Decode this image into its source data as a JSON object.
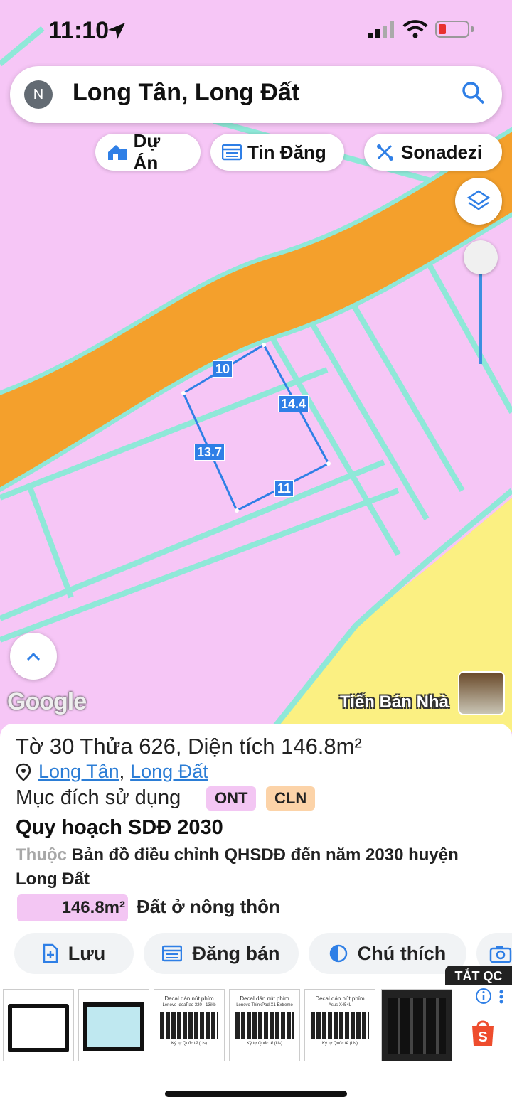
{
  "status_bar": {
    "time": "11:10"
  },
  "search": {
    "avatar_letter": "N",
    "query": "Long Tân, Long Đất"
  },
  "chips": [
    {
      "label": "Dự Án",
      "icon": "house-icon"
    },
    {
      "label": "Tin Đăng",
      "icon": "list-icon"
    },
    {
      "label": "Sonadezi",
      "icon": "tools-icon"
    }
  ],
  "map": {
    "edge_labels": [
      "10",
      "14.4",
      "13.7",
      "11"
    ],
    "google_logo": "Google",
    "watermark": "Tiến Bán Nhà"
  },
  "parcel": {
    "title": "Tờ 30 Thửa 626, Diện tích 146.8m²",
    "ward": "Long Tân",
    "separator": ",",
    "district": "Long Đất",
    "purpose_label": "Mục đích sử dụng",
    "purpose_tags": [
      "ONT",
      "CLN"
    ],
    "plan_title": "Quy hoạch SDĐ 2030",
    "plan_prefix": "Thuộc",
    "plan_desc": "Bản đồ điều chỉnh QHSDĐ đến năm 2030 huyện Long Đất",
    "area_value": "146.8m²",
    "area_type": "Đất ở nông thôn"
  },
  "actions": {
    "save": "Lưu",
    "post": "Đăng bán",
    "legend": "Chú thích"
  },
  "ads": {
    "close_label": "TẮT QC",
    "items": [
      {
        "caption": ""
      },
      {
        "caption": ""
      },
      {
        "caption": "Decal dán nút phím",
        "sub": "Lenovo IdeaPad 320 - 13ikb",
        "foot": "Ký tự Quốc tế (Us)"
      },
      {
        "caption": "Decal dán nút phím",
        "sub": "Lenovo ThinkPad X1 Extreme",
        "foot": "Ký tự Quốc tế (Us)"
      },
      {
        "caption": "Decal dán nút phím",
        "sub": "Asus X454L",
        "foot": "Ký tự Quốc tế (Us)"
      },
      {
        "caption": ""
      }
    ]
  },
  "colors": {
    "accent": "#2f7fe6",
    "road": "#f4a02c",
    "land_residential": "#f6c6f6",
    "land_yellow": "#fbf082",
    "boundary": "#8fe8d8"
  }
}
